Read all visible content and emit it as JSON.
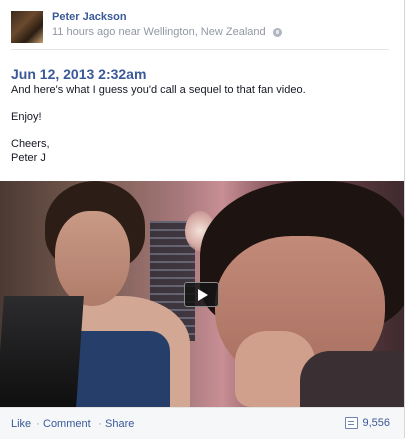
{
  "post": {
    "author": "Peter Jackson",
    "meta": "11 hours ago near Wellington, New Zealand",
    "date": "Jun 12, 2013 2:32am",
    "body": {
      "line1": "And here's what I guess you'd call a sequel to that fan video.",
      "line2": "Enjoy!",
      "line3": "Cheers,",
      "line4": "Peter J"
    }
  },
  "video": {
    "play_icon": "play-icon"
  },
  "actions": {
    "like": "Like",
    "sep": "·",
    "comment": "Comment",
    "share": "Share",
    "comment_count": "9,556"
  },
  "colors": {
    "link": "#3b5998",
    "meta": "#9197a3",
    "action_bar": "#f6f7f9"
  }
}
